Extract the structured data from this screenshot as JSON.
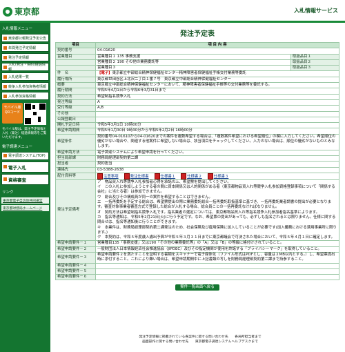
{
  "header": {
    "logo": "東京都",
    "system": "入札情報サービス"
  },
  "sidebar": {
    "menu_title": "入札情報メニュー",
    "items": [
      "東京都公報発注予定公告",
      "年間発注予定情報",
      "発注予定情報",
      "入札(発注・契約)経過情報",
      "入札結果一覧",
      "競争入札参加資格者情報",
      "入札参加資格情報"
    ],
    "mobile_label": "モバイル版 QRコード",
    "mobile_note": "モバイル版は、発注予定情報と入札（発注）経過情報等をご覧いただけます。",
    "big_items": [
      "電子調達システム(TOP)",
      "電子入札",
      "資格審査"
    ],
    "links_title": "リンク",
    "links": [
      "東京都電子自治体共同運営",
      "東京都財務局ホームページ"
    ]
  },
  "page": {
    "title": "発注予定表",
    "col_item": "項目",
    "col_content": "項 目 内 容",
    "rows": [
      {
        "k": "契約番号",
        "v": "04-01620"
      },
      {
        "k": "営業種目",
        "v": "営業種目１ 135 事務支援",
        "r": "取扱品目１"
      },
      {
        "k": "",
        "v": "営業種目２ 190 その他の業務委託等",
        "r": "取扱品目２"
      },
      {
        "k": "",
        "v": "営業種目３",
        "r": "取扱品目３"
      },
      {
        "k": "件　名",
        "pre": "【電子】",
        "v": "東京都立中部総合精神保健福祉センター精神障害者保健福祉手帳交付業務等委託"
      },
      {
        "k": "履行場所",
        "v": "東京都世田谷区上北沢二丁目１番７号　東京都立中部総合精神保健福祉センター"
      },
      {
        "k": "概要",
        "v": "東京都立中部総合精神保健福祉センターにおいて、精神障害者保健福祉手帳等の交付業務等を委託する。"
      },
      {
        "k": "履行期間",
        "v": "令和5年4月1日から令和6年3月31日まで"
      },
      {
        "k": "契約方法",
        "v": "希望制指名競争入札"
      },
      {
        "k": "発注等級",
        "v": "A"
      },
      {
        "k": "受付等級",
        "v": "A,B"
      },
      {
        "k": "その他",
        "v": ""
      },
      {
        "k": "公報登載日",
        "v": ""
      },
      {
        "k": "開札予定日時",
        "v": "令和5年3月1日 10時00分"
      },
      {
        "k": "希望申請期間",
        "v": "令和5年1月30日 9時30分から令和5年2月2日 16時00分"
      },
      {
        "k": "希望条件",
        "v": "契約番号04-01610から04-01620までの案件を複数希望する場合は、「複数案件希望における希望順位」の欄に入力してください。希望順位の優劣がない場合や、関連する他案件に希望しない場合は、該当項目をチェックしてください。入力のない場合は、順位の優劣がないものとみなします。"
      },
      {
        "k": "希望申請方法",
        "v": "電子調達システムにより希望申請を行ってください。"
      },
      {
        "k": "担当局部課",
        "v": "財務局経理部契約第二課"
      },
      {
        "k": "担当者",
        "v": "契約担当"
      },
      {
        "k": "連絡先",
        "v": "03-5388-2638"
      }
    ],
    "docs_label": "配付資料等",
    "docs": [
      "注意事項",
      "発注仕様書",
      "仕様書１",
      "仕様書２",
      "仕様書３"
    ],
    "notes_label": "発注予定備考",
    "notes": [
      "ア　物品買入れ等競争入札参加者心得を承諾の上、希望票を提出してください。",
      "イ　この入札に参加しようとする者の間に資本関係又は人的関係がある者（東京都物品買入れ等競争入札参加資格登録事項について「関係する会社」に当たる者）は参加できません。",
      "ウ　総合及びその構成員が同一の案件を希望することはできません。",
      "エ　一括再委託を予定する総合は、希望票提出の際に業務委託総合一括再委託取扱基準に基づき、一括再委託業者調書の提出が必要となります。審査対象事業者審査方式で登録した総合が入札する場合、総合員ことの一括再委託なければなりません。",
      "オ　契約方法は希望制指名競争入札です。指名業者の選定については、東京都物品買入れ等指名競争入札参加者指名基準によります。",
      "カ　指名等通知は、令和5年2月21日(火)に行う予定です。なお、希望票の提出があっても、必ずしも指名されるとは限りません。仕様に関する問合せは、指名等通知後に行うことができます。",
      "キ　本業件は、財務局経理部契約第二課発注のため、社会保険及び雇用保険に加入していることが必要です(加入義務における適用事業所に限ります。)",
      "ク　本契約は、令和５年度歳入歳出予算が令和５年３月３１日までに東京都議会で可決された場合において、令和５年４月１日に確定します。"
    ],
    "req_rows": [
      {
        "k": "希望申請要件－１",
        "v": "営業種目135「事務支援」又は190「その他の業務委託等」の「A」又は「B」の等級に格付けされていること。"
      },
      {
        "k": "希望申請要件－２",
        "v": "一般財団法人日本情報経済社会推進協会（JIPDEC）及びその指定機関が使用を許諾する「プライバシーマーク」を取得していること。"
      },
      {
        "k": "希望申請要件－３",
        "v": "希望申請要件２を満たすことを証明する書類をスキャナーで電子媒体化（ファイル形式はPDFとし、容量は２MB以内とする。）し、希望票提出時に添付すること。これにより難い場合は、希望申請期間中に上記書類の写しを財務局経理部契約第二課まで持参すること。"
      },
      {
        "k": "希望申請要件－４",
        "v": ""
      },
      {
        "k": "希望申請要件－５",
        "v": ""
      },
      {
        "k": "希望申請要件－６",
        "v": ""
      }
    ],
    "back_button": "案件一覧画面へ戻る"
  },
  "footer": {
    "line1": "発注予定情報に掲載されている各案件に関する問い合わせ先　　各局所担当者まで",
    "line2": "画面操作に関する問い合わせ先　　東京都電子調達システムヘルプデスクまで"
  }
}
